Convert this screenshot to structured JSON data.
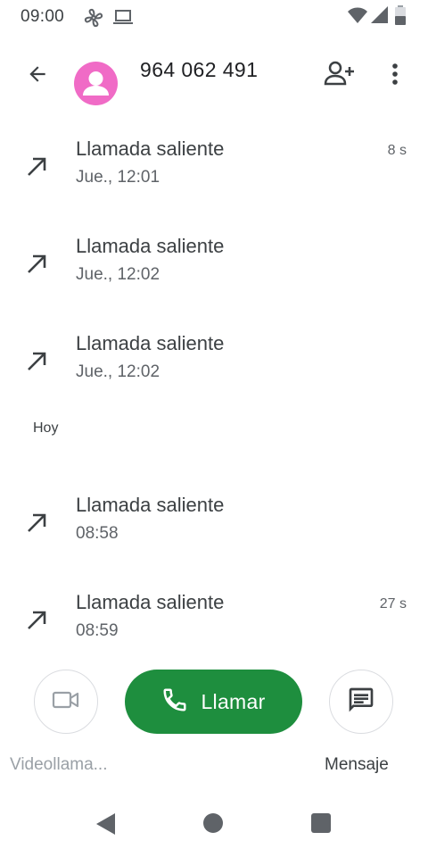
{
  "status_bar": {
    "time": "09:00",
    "icons": [
      "fan-icon",
      "laptop-icon",
      "wifi-icon",
      "signal-icon",
      "battery-icon"
    ]
  },
  "header": {
    "back_icon": "arrow-back-icon",
    "avatar_icon": "person-icon",
    "contact_number": "964 062 491",
    "add_contact_icon": "person-add-icon",
    "more_icon": "more-vert-icon"
  },
  "calls": [
    {
      "type": "Llamada saliente",
      "time": "Jue., 12:01",
      "duration": "8 s"
    },
    {
      "type": "Llamada saliente",
      "time": "Jue., 12:02",
      "duration": ""
    },
    {
      "type": "Llamada saliente",
      "time": "Jue., 12:02",
      "duration": ""
    },
    {
      "type": "Llamada saliente",
      "time": "08:58",
      "duration": ""
    },
    {
      "type": "Llamada saliente",
      "time": "08:59",
      "duration": "27 s"
    }
  ],
  "section_today": "Hoy",
  "actions": {
    "video_label": "Videollama...",
    "call_label": "Llamar",
    "message_label": "Mensaje"
  },
  "colors": {
    "avatar": "#f06bc6",
    "call_button": "#1e8e3e",
    "icon": "#3c4043"
  }
}
